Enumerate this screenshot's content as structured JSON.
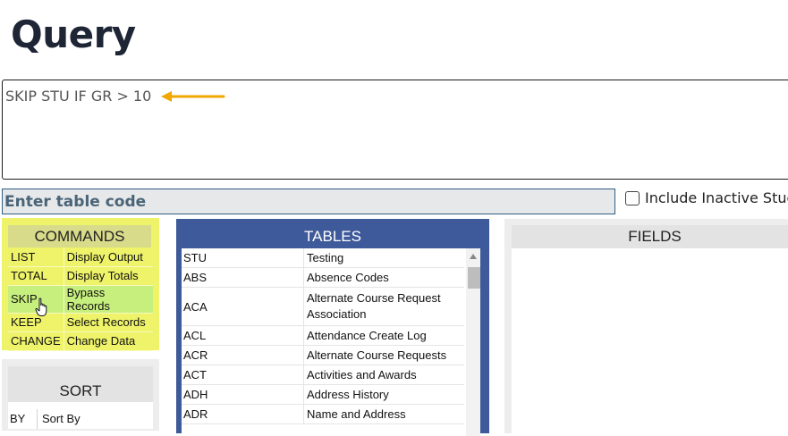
{
  "page": {
    "title": "Query"
  },
  "query": {
    "text": "SKIP STU IF GR > 10"
  },
  "table_code": {
    "placeholder": "Enter table code"
  },
  "include_inactive": {
    "label": "Include Inactive Stud",
    "checked": false
  },
  "colors": {
    "commands_bg": "#eef36a",
    "commands_highlight": "#c7ef7d",
    "tables_bg": "#3e5a9a",
    "arrow": "#f0a800"
  },
  "commands": {
    "header": "COMMANDS",
    "items": [
      {
        "key": "LIST",
        "desc": "Display Output"
      },
      {
        "key": "TOTAL",
        "desc": "Display Totals"
      },
      {
        "key": "SKIP",
        "desc": "Bypass Records"
      },
      {
        "key": "KEEP",
        "desc": "Select Records"
      },
      {
        "key": "CHANGE",
        "desc": "Change Data"
      }
    ]
  },
  "sort": {
    "header": "SORT",
    "items": [
      {
        "key": "BY",
        "desc": "Sort By"
      }
    ]
  },
  "tables": {
    "header": "TABLES",
    "items": [
      {
        "code": "STU",
        "desc": "Testing"
      },
      {
        "code": "ABS",
        "desc": "Absence Codes"
      },
      {
        "code": "ACA",
        "desc": "Alternate Course Request Association"
      },
      {
        "code": "ACL",
        "desc": "Attendance Create Log"
      },
      {
        "code": "ACR",
        "desc": "Alternate Course Requests"
      },
      {
        "code": "ACT",
        "desc": "Activities and Awards"
      },
      {
        "code": "ADH",
        "desc": "Address History"
      },
      {
        "code": "ADR",
        "desc": "Name and Address"
      }
    ]
  },
  "fields": {
    "header": "FIELDS"
  },
  "icons": {
    "arrow": "left-arrow-icon",
    "cursor": "hand-pointer-icon",
    "scroll": "scroll-up-icon"
  }
}
